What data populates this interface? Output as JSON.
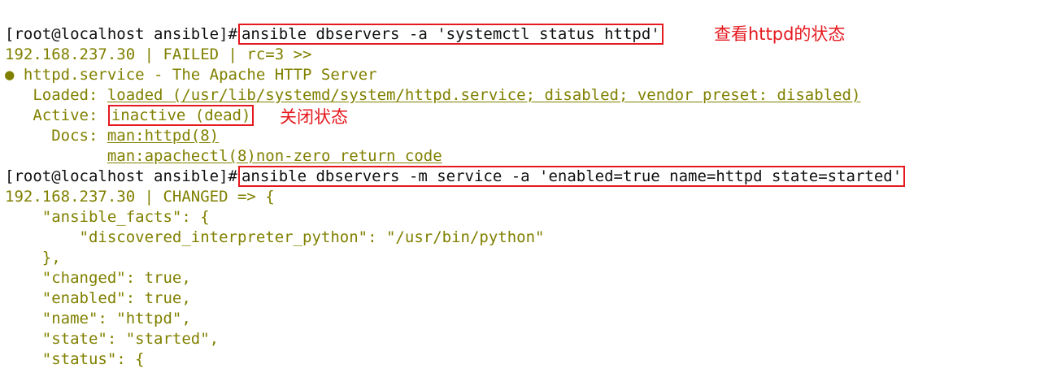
{
  "terminal": {
    "line1": {
      "prompt": "[root@localhost ansible]#",
      "command": "ansible dbservers -a 'systemctl status httpd'",
      "note": "查看httpd的状态"
    },
    "line2": "192.168.237.30 | FAILED | rc=3 >>",
    "line3": "● httpd.service - The Apache HTTP Server",
    "line4": {
      "label": "   Loaded: ",
      "value": "loaded (/usr/lib/systemd/system/httpd.service; disabled; vendor preset: disabled)"
    },
    "line5": {
      "label": "   Active: ",
      "value": "inactive (dead)",
      "note": "关闭状态"
    },
    "line6": {
      "label": "     Docs: ",
      "value": "man:httpd(8)"
    },
    "line7": {
      "indent": "           ",
      "value": "man:apachectl(8)non-zero return code"
    },
    "line8": {
      "prompt": "[root@localhost ansible]#",
      "command": "ansible dbservers -m service -a 'enabled=true name=httpd state=started'"
    },
    "json_lines": [
      "192.168.237.30 | CHANGED => {",
      "    \"ansible_facts\": {",
      "        \"discovered_interpreter_python\": \"/usr/bin/python\"",
      "    },",
      "    \"changed\": true,",
      "    \"enabled\": true,",
      "    \"name\": \"httpd\",",
      "    \"state\": \"started\",",
      "    \"status\": {"
    ],
    "colors": {
      "output": "#808000",
      "text": "#111111",
      "highlight": "#e5191e"
    }
  }
}
